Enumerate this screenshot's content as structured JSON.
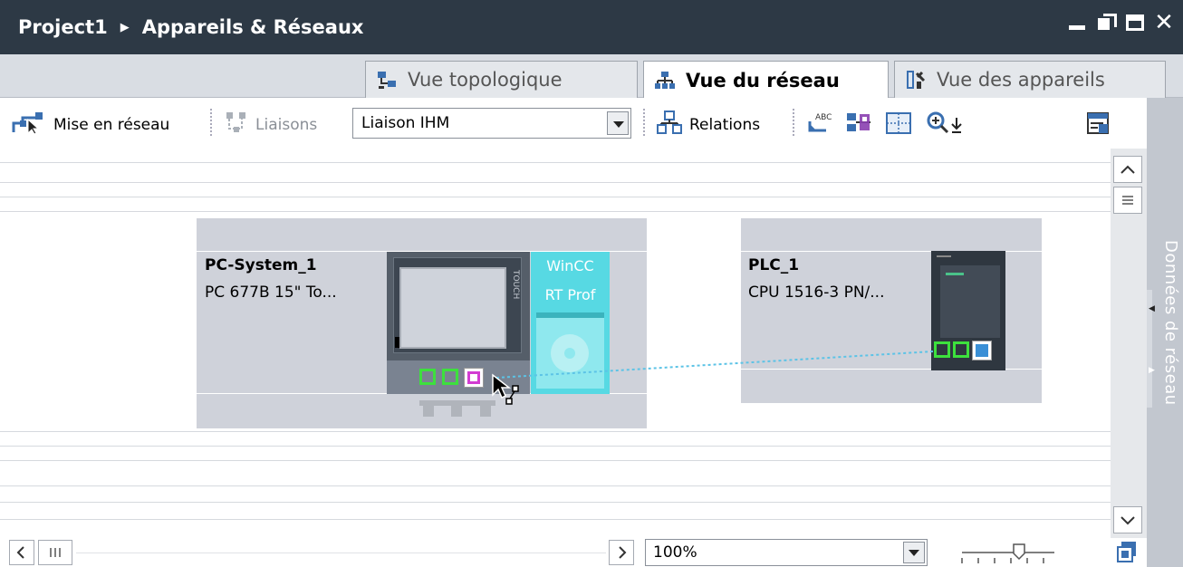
{
  "breadcrumb": {
    "project": "Project1",
    "page": "Appareils & Réseaux"
  },
  "tabs": [
    {
      "label": "Vue topologique",
      "active": false
    },
    {
      "label": "Vue du réseau",
      "active": true
    },
    {
      "label": "Vue des appareils",
      "active": false
    }
  ],
  "toolbar": {
    "network_mode_label": "Mise en réseau",
    "connections_label": "Liaisons",
    "connection_type_value": "Liaison IHM",
    "relations_label": "Relations"
  },
  "devices": [
    {
      "name": "PC-System_1",
      "type": "PC 677B 15\" To...",
      "runtime_line1": "WinCC",
      "runtime_line2": "RT Prof",
      "panel_text": "TOUCH"
    },
    {
      "name": "PLC_1",
      "type": "CPU 1516-3 PN/..."
    }
  ],
  "side_panel_label": "Données de réseau",
  "zoom_value": "100%",
  "colors": {
    "title_bar": "#2d3945",
    "device_box": "#cfd2da",
    "port_green": "#3de03d",
    "runtime_cyan": "#57d9e3",
    "link_line": "#5cc3e6",
    "hmi_port": "#d23cd2"
  }
}
